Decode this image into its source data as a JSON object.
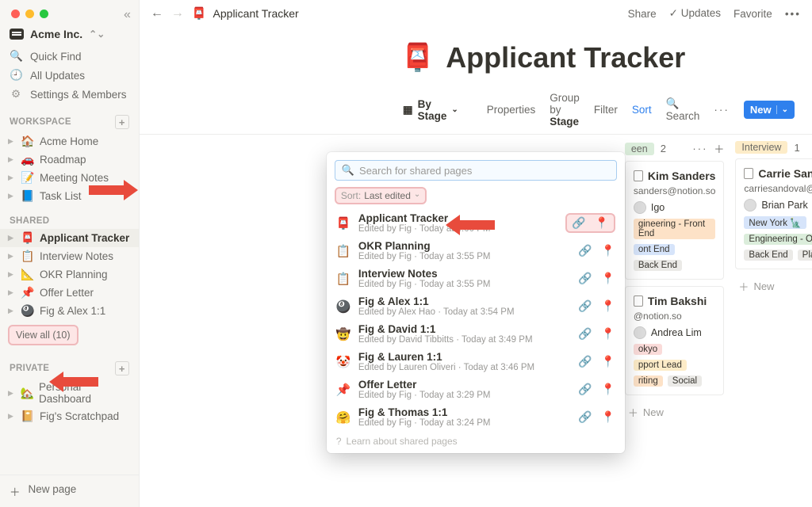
{
  "workspace_name": "Acme Inc.",
  "nav": {
    "quick_find": "Quick Find",
    "all_updates": "All Updates",
    "settings": "Settings & Members"
  },
  "sections": {
    "workspace": "WORKSPACE",
    "shared": "SHARED",
    "private": "PRIVATE"
  },
  "workspace_pages": [
    {
      "emoji": "🏠",
      "label": "Acme Home"
    },
    {
      "emoji": "🚗",
      "label": "Roadmap"
    },
    {
      "emoji": "📝",
      "label": "Meeting Notes"
    },
    {
      "emoji": "📘",
      "label": "Task List"
    }
  ],
  "shared_pages": [
    {
      "emoji": "📮",
      "label": "Applicant Tracker",
      "selected": true
    },
    {
      "emoji": "📋",
      "label": "Interview Notes"
    },
    {
      "emoji": "📐",
      "label": "OKR Planning"
    },
    {
      "emoji": "📌",
      "label": "Offer Letter"
    },
    {
      "emoji": "🎱",
      "label": "Fig & Alex 1:1"
    }
  ],
  "view_all": "View all (10)",
  "private_pages": [
    {
      "emoji": "🏡",
      "label": "Personal Dashboard"
    },
    {
      "emoji": "📔",
      "label": "Fig's Scratchpad"
    }
  ],
  "new_page": "New page",
  "topbar": {
    "title": "Applicant Tracker",
    "share": "Share",
    "updates": "Updates",
    "favorite": "Favorite"
  },
  "hero": {
    "emoji": "📮",
    "title": "Applicant Tracker"
  },
  "toolbar": {
    "view": "By Stage",
    "properties": "Properties",
    "group_prefix": "Group by ",
    "group_value": "Stage",
    "filter": "Filter",
    "sort": "Sort",
    "search": "Search",
    "new": "New"
  },
  "board": {
    "col1": {
      "name": "Screen",
      "count": "2",
      "head_extra": "een"
    },
    "col2": {
      "name": "Interview",
      "count": "1"
    },
    "card1": {
      "name": "Kim Sanders",
      "name_vis": "Kim Sanders",
      "email": "sanders@notion.so",
      "person": "Igo",
      "loc": "",
      "tags": [
        "gineering - Front End",
        "ont End",
        "Back End"
      ]
    },
    "card2": {
      "name": "Tim Bakshi",
      "email": "@notion.so",
      "person": "Andrea Lim",
      "loc": "okyo",
      "tags": [
        "pport Lead",
        "riting",
        "Social"
      ]
    },
    "card3": {
      "name": "Carrie Sandoval",
      "email": "carriesandoval@notion.so",
      "person": "Brian Park",
      "loc": "New York 🗽",
      "tags": [
        "Engineering - Ops",
        "Back End",
        "Platform"
      ]
    },
    "add_new": "New"
  },
  "popover": {
    "search_placeholder": "Search for shared pages",
    "sort_label": "Sort:",
    "sort_value": "Last edited",
    "items": [
      {
        "emoji": "📮",
        "title": "Applicant Tracker",
        "sub": "Edited by Fig · Today at 4:00 PM",
        "hl": true
      },
      {
        "emoji": "📋",
        "title": "OKR Planning",
        "sub": "Edited by Fig · Today at 3:55 PM"
      },
      {
        "emoji": "📋",
        "title": "Interview Notes",
        "sub": "Edited by Fig · Today at 3:55 PM"
      },
      {
        "emoji": "🎱",
        "title": "Fig & Alex 1:1",
        "sub": "Edited by Alex Hao · Today at 3:54 PM"
      },
      {
        "emoji": "🤠",
        "title": "Fig & David 1:1",
        "sub": "Edited by David Tibbitts · Today at 3:49 PM"
      },
      {
        "emoji": "🤡",
        "title": "Fig & Lauren 1:1",
        "sub": "Edited by Lauren Oliveri · Today at 3:46 PM"
      },
      {
        "emoji": "📌",
        "title": "Offer Letter",
        "sub": "Edited by Fig · Today at 3:29 PM"
      },
      {
        "emoji": "🤗",
        "title": "Fig & Thomas 1:1",
        "sub": "Edited by Fig · Today at 3:24 PM"
      }
    ],
    "footer": "Learn about shared pages"
  }
}
